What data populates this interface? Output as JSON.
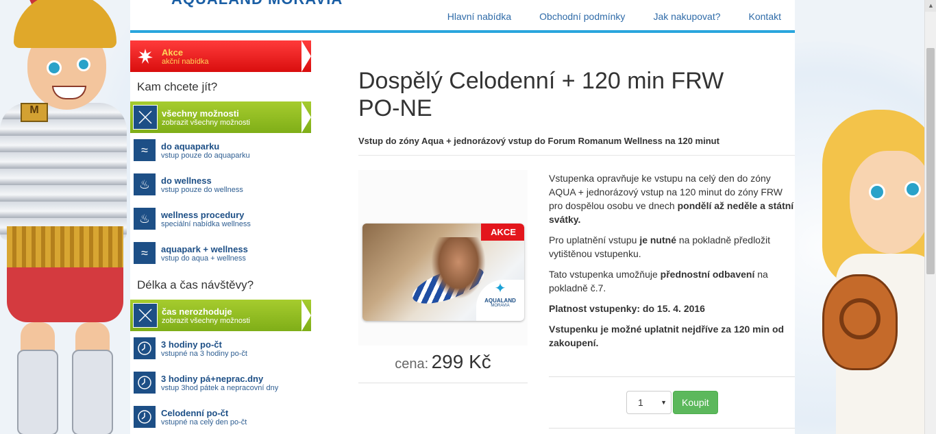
{
  "brand": {
    "logo_text": "AQUALAND MORAVIA"
  },
  "topnav": {
    "items": [
      "Hlavní nabídka",
      "Obchodní podmínky",
      "Jak nakupovat?",
      "Kontakt"
    ]
  },
  "sidebar": {
    "promo": {
      "title": "Akce",
      "subtitle": "akční nabídka"
    },
    "where_heading": "Kam chcete jít?",
    "where_all": {
      "title": "všechny možnosti",
      "subtitle": "zobrazit všechny možnosti"
    },
    "where_items": [
      {
        "title": "do aquaparku",
        "subtitle": "vstup pouze do aquaparku",
        "icon": "swimmer-icon"
      },
      {
        "title": "do wellness",
        "subtitle": "vstup pouze do wellness",
        "icon": "sauna-icon"
      },
      {
        "title": "wellness procedury",
        "subtitle": "speciální nabídka wellness",
        "icon": "sauna-icon"
      },
      {
        "title": "aquapark + wellness",
        "subtitle": "vstup do aqua + wellness",
        "icon": "swimmer-sauna-icon"
      }
    ],
    "duration_heading": "Délka a čas návštěvy?",
    "duration_all": {
      "title": "čas nerozhoduje",
      "subtitle": "zobrazit všechny možnosti"
    },
    "duration_items": [
      {
        "title": "3 hodiny po-čt",
        "subtitle": "vstupné na 3 hodiny po-čt",
        "icon": "clock-icon"
      },
      {
        "title": "3 hodiny pá+neprac.dny",
        "subtitle": "vstup 3hod pátek a nepracovní dny",
        "icon": "clock-icon"
      },
      {
        "title": "Celodenní po-čt",
        "subtitle": "vstupné na celý den po-čt",
        "icon": "clock-icon"
      }
    ]
  },
  "product": {
    "title": "Dospělý Celodenní + 120 min FRW PO-NE",
    "subtitle": "Vstup do zóny Aqua + jednorázový vstup do Forum Romanum Wellness na 120 minut",
    "badge": "AKCE",
    "ticket_logo": "AQUALAND",
    "ticket_logo_sub": "MORAVIA",
    "price_label": "cena:",
    "price_value": "299 Kč",
    "desc1_a": "Vstupenka opravňuje ke vstupu na celý den do zóny AQUA + jednorázový vstup na 120 minut do zóny FRW pro dospělou osobu ve dnech ",
    "desc1_b": "pondělí až neděle a státní svátky.",
    "desc2_a": "Pro uplatnění vstupu ",
    "desc2_b": "je nutné",
    "desc2_c": " na pokladně předložit vytištěnou vstupenku.",
    "desc3_a": "Tato vstupenka umožňuje ",
    "desc3_b": "přednostní odbavení",
    "desc3_c": " na pokladně č.7.",
    "validity": "Platnost vstupenky: do 15. 4. 2016",
    "note": "Vstupenku je možné uplatnit nejdříve za 120 min od zakoupení.",
    "quantity": "1",
    "buy_label": "Koupit"
  }
}
